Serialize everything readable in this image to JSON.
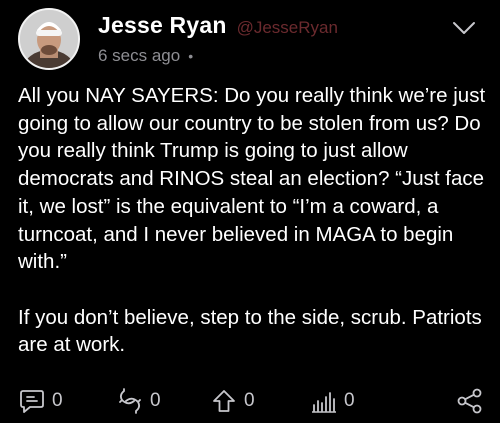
{
  "author": {
    "display_name": "Jesse Ryan",
    "handle": "@JesseRyan",
    "avatar_icon": "avatar-photo"
  },
  "meta": {
    "timestamp": "6 secs ago",
    "separator": "•"
  },
  "post": {
    "paragraphs": [
      "All you NAY SAYERS: Do you really think we’re just going to allow our country to be stolen from us? Do you really think Trump is going to just allow democrats and RINOS steal an election? “Just face it, we lost” is the equivalent to “I’m a coward, a turncoat, and I never believed in MAGA to begin with.”",
      "If you don’t believe, step to the side, scrub. Patriots are at work."
    ]
  },
  "actions": {
    "reply": {
      "icon": "speech-bubble-icon",
      "count": "0"
    },
    "repost": {
      "icon": "repost-icon",
      "count": "0"
    },
    "upvote": {
      "icon": "arrow-up-icon",
      "count": "0"
    },
    "views": {
      "icon": "bar-chart-icon",
      "count": "0"
    },
    "share": {
      "icon": "share-icon"
    }
  },
  "colors": {
    "background": "#000000",
    "text": "#ffffff",
    "handle": "#6b2a2e",
    "muted": "#8e8e93",
    "icon": "#c7c7cc"
  }
}
